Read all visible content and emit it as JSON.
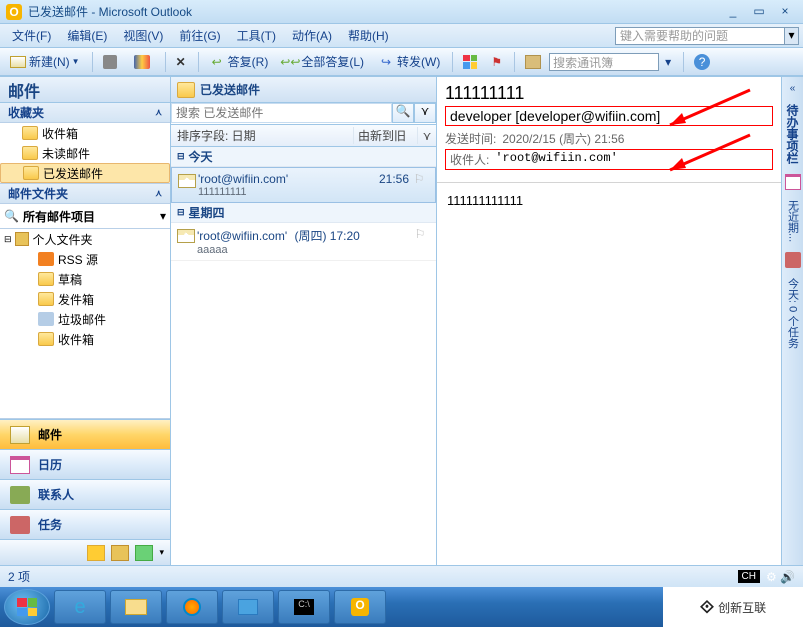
{
  "window": {
    "title": "已发送邮件 - Microsoft Outlook"
  },
  "menu": {
    "file": "文件(F)",
    "edit": "编辑(E)",
    "view": "视图(V)",
    "goto": "前往(G)",
    "tools": "工具(T)",
    "actions": "动作(A)",
    "help": "帮助(H)",
    "helpbox_placeholder": "键入需要帮助的问题"
  },
  "toolbar": {
    "new": "新建(N)",
    "reply": "答复(R)",
    "reply_all": "全部答复(L)",
    "forward": "转发(W)",
    "search_placeholder": "搜索通讯簿"
  },
  "nav": {
    "title": "邮件",
    "fav_title": "收藏夹",
    "fav": {
      "inbox": "收件箱",
      "unread": "未读邮件",
      "sent": "已发送邮件"
    },
    "folders_title": "邮件文件夹",
    "all": "所有邮件项目",
    "personal": "个人文件夹",
    "rss": "RSS 源",
    "drafts": "草稿",
    "outbox": "发件箱",
    "junk": "垃圾邮件",
    "inbox2": "收件箱",
    "btn_mail": "邮件",
    "btn_cal": "日历",
    "btn_contacts": "联系人",
    "btn_tasks": "任务"
  },
  "list": {
    "header": "已发送邮件",
    "search_placeholder": "搜索 已发送邮件",
    "sort_by": "排序字段: 日期",
    "sort_dir": "由新到旧",
    "group_today": "今天",
    "group_thursday": "星期四",
    "msg1": {
      "to": "'root@wifiin.com'",
      "subj": "111111111",
      "time": "21:56"
    },
    "msg2": {
      "to": "'root@wifiin.com'",
      "subj": "aaaaa",
      "time": "(周四) 17:20"
    }
  },
  "read": {
    "subject": "111111111",
    "from": "developer [developer@wifiin.com]",
    "sent_lbl": "发送时间:",
    "sent_val": "2020/2/15 (周六) 21:56",
    "to_lbl": "收件人:",
    "to_val": "'root@wifiin.com'",
    "body": "111111111111"
  },
  "right": {
    "todo": "待办事项栏",
    "nopref": "无近期...",
    "today": "今天: 0 个任务"
  },
  "status": {
    "items": "2 项"
  },
  "brand": "创新互联"
}
